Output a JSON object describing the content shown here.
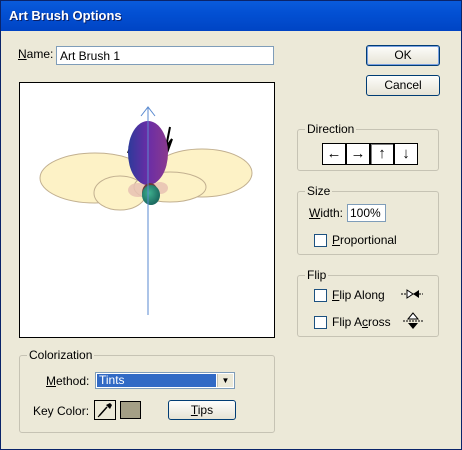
{
  "window": {
    "title": "Art Brush Options"
  },
  "name_field": {
    "label": "Name:",
    "value": "Art Brush 1"
  },
  "buttons": {
    "ok": "OK",
    "cancel": "Cancel",
    "tips": "Tips"
  },
  "direction": {
    "legend": "Direction",
    "arrows": [
      "←",
      "→",
      "↑",
      "↓"
    ],
    "selected": "↑"
  },
  "size": {
    "legend": "Size",
    "width_label": "Width:",
    "width_value": "100%",
    "proportional_label": "Proportional",
    "proportional_checked": false
  },
  "flip": {
    "legend": "Flip",
    "along_label": "Flip Along",
    "across_label": "Flip Across",
    "along_checked": false,
    "across_checked": false
  },
  "colorization": {
    "legend": "Colorization",
    "method_label": "Method:",
    "method_value": "Tints",
    "key_color_label": "Key Color:",
    "key_color": "#A49F85"
  },
  "colors": {
    "titlebar": "#0350D3",
    "dialog_bg": "#ECE9D8",
    "selection": "#316AC5",
    "wing_fill": "#FDF2C6",
    "body_purple": "#5A2A95",
    "body_teal": "#1E7A6A"
  },
  "preview": {
    "icon": "butterfly-art-brush-preview"
  }
}
